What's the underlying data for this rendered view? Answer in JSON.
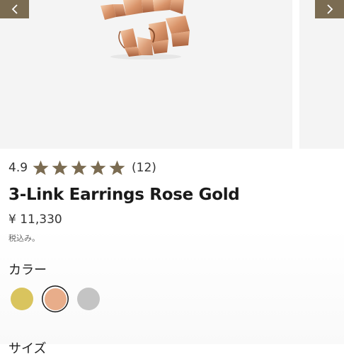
{
  "gallery": {
    "image_name": "rose-gold-3-link-earring",
    "prev_icon": "chevron-left-icon",
    "next_icon": "chevron-right-icon"
  },
  "product": {
    "rating_value": "4.9",
    "rating_fraction": 0.98,
    "stars_filled": 5,
    "rating_count": "(12)",
    "title": "3-Link Earrings Rose Gold",
    "price": "¥ 11,330",
    "tax_note": "税込み。"
  },
  "options": {
    "color_label": "カラー",
    "swatches": [
      {
        "name": "gold",
        "color": "#d9c45e",
        "selected": false
      },
      {
        "name": "rose-gold",
        "color": "#e8ad8a",
        "selected": true
      },
      {
        "name": "silver",
        "color": "#c4c4c4",
        "selected": false
      }
    ],
    "size_label": "サイズ"
  },
  "colors": {
    "accent": "#7b6c52",
    "star": "#7b6c52",
    "image_bg": "#f4f4f4"
  }
}
